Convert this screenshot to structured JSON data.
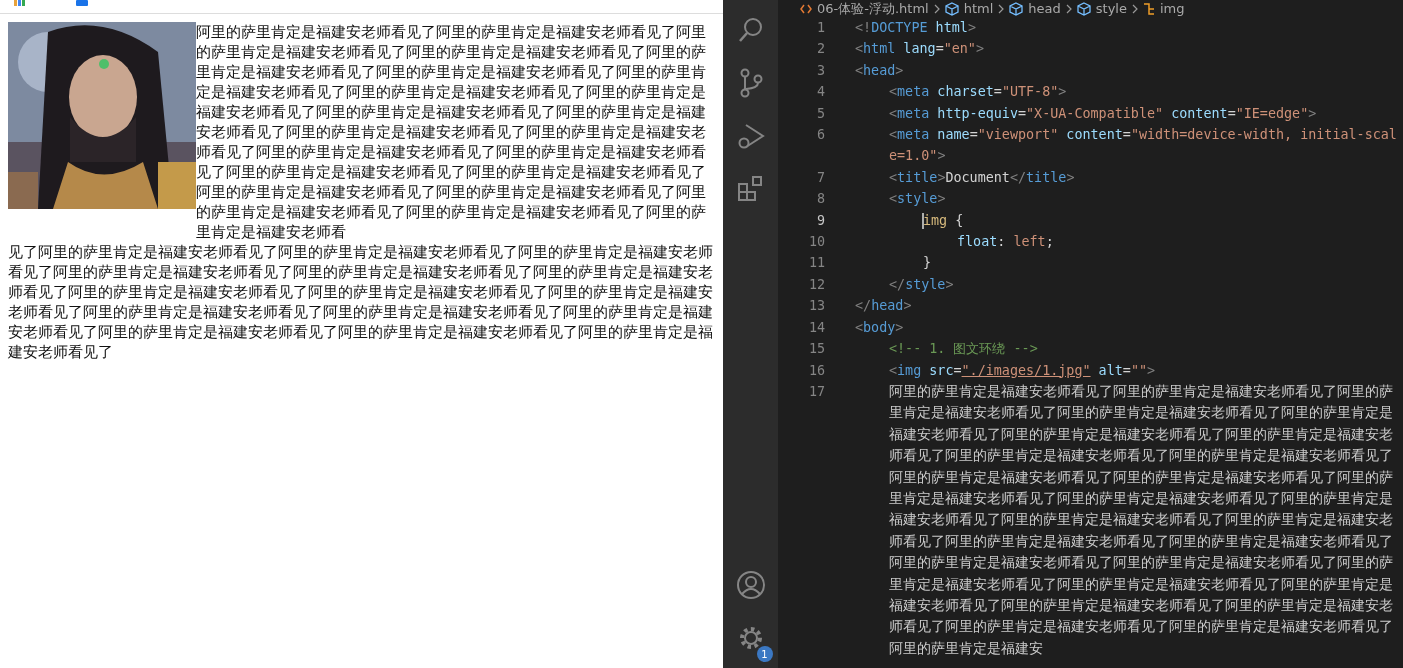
{
  "browser": {
    "text_beside_picture": "阿里的萨里肯定是福建安老师看见了阿里的萨里肯定是福建安老师看见了阿里的萨里肯定是福建安老师看见了阿里的萨里肯定是福建安老师看见了阿里的萨里肯定是福建安老师看见了阿里的萨里肯定是福建安老师看见了阿里的萨里肯定是福建安老师看见了阿里的萨里肯定是福建安老师看见了阿里的萨里肯定是福建安老师看见了阿里的萨里肯定是福建安老师看见了阿里的萨里肯定是福建安老师看见了阿里的萨里肯定是福建安老师看见了阿里的萨里肯定是福建安老师看见了阿里的萨里肯定是福建安老师看见了阿里的萨里肯定是福建安老师看见了阿里的萨里肯定是福建安老师看见了阿里的萨里肯定是福建安老师看见了阿里的萨里肯定是福建安老师看见了阿里的萨里肯定是福建安老师看见了阿里的萨里肯定是福建安老师看见了阿里的萨里肯定是福建安老师看见了阿里的萨里肯定是福建安老师看",
    "text_below_picture": "见了阿里的萨里肯定是福建安老师看见了阿里的萨里肯定是福建安老师看见了阿里的萨里肯定是福建安老师看见了阿里的萨里肯定是福建安老师看见了阿里的萨里肯定是福建安老师看见了阿里的萨里肯定是福建安老师看见了阿里的萨里肯定是福建安老师看见了阿里的萨里肯定是福建安老师看见了阿里的萨里肯定是福建安老师看见了阿里的萨里肯定是福建安老师看见了阿里的萨里肯定是福建安老师看见了阿里的萨里肯定是福建安老师看见了阿里的萨里肯定是福建安老师看见了阿里的萨里肯定是福建安老师看见了阿里的萨里肯定是福建安老师看见了"
  },
  "editor": {
    "breadcrumbs": [
      {
        "label": "06-体验-浮动.html",
        "kind": "file"
      },
      {
        "label": "html",
        "kind": "element"
      },
      {
        "label": "head",
        "kind": "element"
      },
      {
        "label": "style",
        "kind": "element"
      },
      {
        "label": "img",
        "kind": "selector"
      }
    ],
    "settings_badge": "1",
    "lines": [
      {
        "number": "1",
        "tokens": [
          {
            "kind": "punct",
            "text": "<!"
          },
          {
            "kind": "tag",
            "text": "DOCTYPE"
          },
          {
            "kind": "attr",
            "text": " html"
          },
          {
            "kind": "punct",
            "text": ">"
          }
        ]
      },
      {
        "number": "2",
        "tokens": [
          {
            "kind": "punct",
            "text": "<"
          },
          {
            "kind": "tag",
            "text": "html"
          },
          {
            "kind": "attr",
            "text": " lang"
          },
          {
            "kind": "plain",
            "text": "="
          },
          {
            "kind": "string",
            "text": "\"en\""
          },
          {
            "kind": "punct",
            "text": ">"
          }
        ]
      },
      {
        "number": "3",
        "tokens": [
          {
            "kind": "punct",
            "text": "<"
          },
          {
            "kind": "tag",
            "text": "head"
          },
          {
            "kind": "punct",
            "text": ">"
          }
        ],
        "children": [
          {
            "number": "4",
            "tokens": [
              {
                "kind": "punct",
                "text": "<"
              },
              {
                "kind": "tag",
                "text": "meta"
              },
              {
                "kind": "attr",
                "text": " charset"
              },
              {
                "kind": "plain",
                "text": "="
              },
              {
                "kind": "string",
                "text": "\"UTF-8\""
              },
              {
                "kind": "punct",
                "text": ">"
              }
            ]
          },
          {
            "number": "5",
            "tokens": [
              {
                "kind": "punct",
                "text": "<"
              },
              {
                "kind": "tag",
                "text": "meta"
              },
              {
                "kind": "attr",
                "text": " http-equiv"
              },
              {
                "kind": "plain",
                "text": "="
              },
              {
                "kind": "string",
                "text": "\"X-UA-Compatible\""
              },
              {
                "kind": "attr",
                "text": " content"
              },
              {
                "kind": "plain",
                "text": "="
              },
              {
                "kind": "string",
                "text": "\"IE=edge\""
              },
              {
                "kind": "punct",
                "text": ">"
              }
            ]
          },
          {
            "number": "6",
            "tokens": [
              {
                "kind": "punct",
                "text": "<"
              },
              {
                "kind": "tag",
                "text": "meta"
              },
              {
                "kind": "attr",
                "text": " name"
              },
              {
                "kind": "plain",
                "text": "="
              },
              {
                "kind": "string",
                "text": "\"viewport\""
              },
              {
                "kind": "attr",
                "text": " content"
              },
              {
                "kind": "plain",
                "text": "="
              },
              {
                "kind": "string",
                "text": "\"width=device-width, initial-scale=1.0\""
              },
              {
                "kind": "punct",
                "text": ">"
              }
            ]
          },
          {
            "number": "7",
            "tokens": [
              {
                "kind": "punct",
                "text": "<"
              },
              {
                "kind": "tag",
                "text": "title"
              },
              {
                "kind": "punct",
                "text": ">"
              },
              {
                "kind": "plain",
                "text": "Document"
              },
              {
                "kind": "punct",
                "text": "</"
              },
              {
                "kind": "tag",
                "text": "title"
              },
              {
                "kind": "punct",
                "text": ">"
              }
            ]
          },
          {
            "number": "8",
            "tokens": [
              {
                "kind": "punct",
                "text": "<"
              },
              {
                "kind": "tag",
                "text": "style"
              },
              {
                "kind": "punct",
                "text": ">"
              }
            ],
            "children": [
              {
                "number": "9",
                "current": true,
                "tokens": [
                  {
                    "kind": "selector",
                    "text": "img"
                  },
                  {
                    "kind": "plain",
                    "text": " {"
                  }
                ],
                "children": [
                  {
                    "number": "10",
                    "tokens": [
                      {
                        "kind": "attr",
                        "text": "float"
                      },
                      {
                        "kind": "plain",
                        "text": ": "
                      },
                      {
                        "kind": "string",
                        "text": "left"
                      },
                      {
                        "kind": "plain",
                        "text": ";"
                      }
                    ]
                  }
                ]
              },
              {
                "number": "11",
                "tokens": [
                  {
                    "kind": "plain",
                    "text": "}"
                  }
                ]
              }
            ]
          },
          {
            "number": "12",
            "tokens": [
              {
                "kind": "punct",
                "text": "</"
              },
              {
                "kind": "tag",
                "text": "style"
              },
              {
                "kind": "punct",
                "text": ">"
              }
            ]
          }
        ]
      },
      {
        "number": "13",
        "tokens": [
          {
            "kind": "punct",
            "text": "</"
          },
          {
            "kind": "tag",
            "text": "head"
          },
          {
            "kind": "punct",
            "text": ">"
          }
        ]
      },
      {
        "number": "14",
        "tokens": [
          {
            "kind": "punct",
            "text": "<"
          },
          {
            "kind": "tag",
            "text": "body"
          },
          {
            "kind": "punct",
            "text": ">"
          }
        ],
        "children": [
          {
            "number": "15",
            "tokens": [
              {
                "kind": "comment",
                "text": "<!-- 1. 图文环绕 -->"
              }
            ]
          },
          {
            "number": "16",
            "tokens": [
              {
                "kind": "punct",
                "text": "<"
              },
              {
                "kind": "tag",
                "text": "img"
              },
              {
                "kind": "attr",
                "text": " src"
              },
              {
                "kind": "plain",
                "text": "="
              },
              {
                "kind": "link",
                "text": "\"./images/1.jpg\""
              },
              {
                "kind": "attr",
                "text": " alt"
              },
              {
                "kind": "plain",
                "text": "="
              },
              {
                "kind": "string",
                "text": "\"\""
              },
              {
                "kind": "punct",
                "text": ">"
              }
            ]
          },
          {
            "number": "17",
            "tokens": [
              {
                "kind": "cjk",
                "text": "阿里的萨里肯定是福建安老师看见了阿里的萨里肯定是福建安老师看见了阿里的萨里肯定是福建安老师看见了阿里的萨里肯定是福建安老师看见了阿里的萨里肯定是福建安老师看见了阿里的萨里肯定是福建安老师看见了阿里的萨里肯定是福建安老师看见了阿里的萨里肯定是福建安老师看见了阿里的萨里肯定是福建安老师看见了阿里的萨里肯定是福建安老师看见了阿里的萨里肯定是福建安老师看见了阿里的萨里肯定是福建安老师看见了阿里的萨里肯定是福建安老师看见了阿里的萨里肯定是福建安老师看见了阿里的萨里肯定是福建安老师看见了阿里的萨里肯定是福建安老师看见了阿里的萨里肯定是福建安老师看见了阿里的萨里肯定是福建安老师看见了阿里的萨里肯定是福建安老师看见了阿里的萨里肯定是福建安老师看见了阿里的萨里肯定是福建安老师看见了阿里的萨里肯定是福建安老师看见了阿里的萨里肯定是福建安老师看见了阿里的萨里肯定是福建安老师看见了阿里的萨里肯定是福建安老师看见了阿里的萨里肯定是福建安老师看见了阿里的萨里肯定是福建安老师看见了阿里的萨里肯定是福建安"
              }
            ]
          }
        ]
      }
    ]
  }
}
